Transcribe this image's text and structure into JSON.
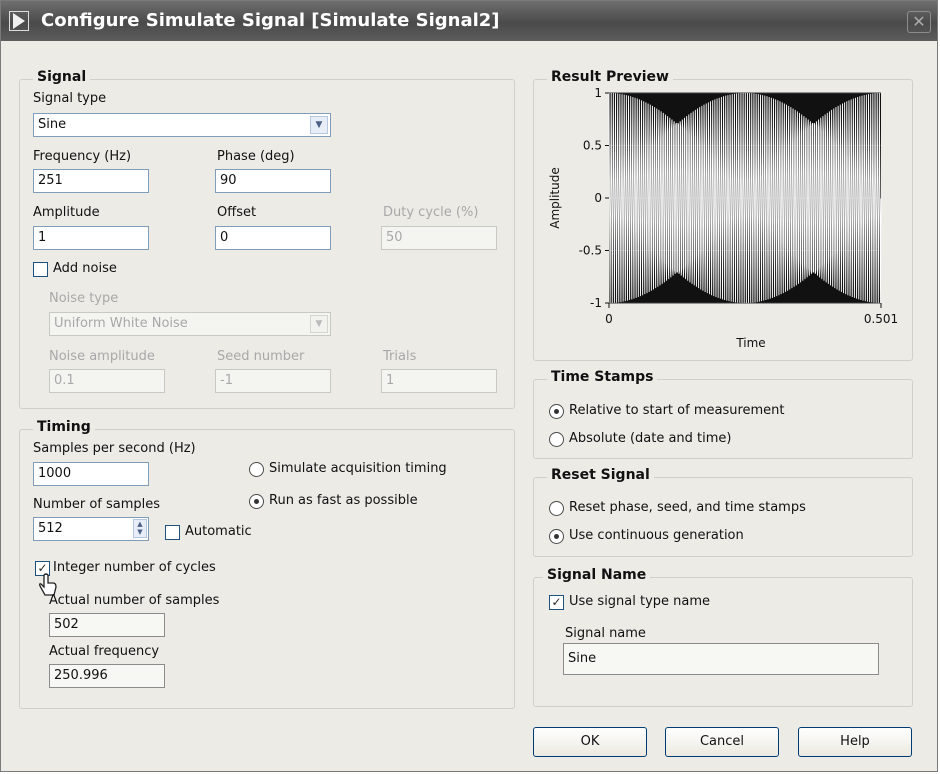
{
  "window": {
    "title": "Configure Simulate Signal [Simulate Signal2]",
    "close_glyph": "✕"
  },
  "signal": {
    "group_title": "Signal",
    "signal_type_label": "Signal type",
    "signal_type_value": "Sine",
    "frequency_label": "Frequency (Hz)",
    "frequency_value": "251",
    "phase_label": "Phase (deg)",
    "phase_value": "90",
    "amplitude_label": "Amplitude",
    "amplitude_value": "1",
    "offset_label": "Offset",
    "offset_value": "0",
    "duty_cycle_label": "Duty cycle (%)",
    "duty_cycle_value": "50",
    "add_noise_label": "Add noise",
    "add_noise_checked": false,
    "noise_type_label": "Noise type",
    "noise_type_value": "Uniform White Noise",
    "noise_amplitude_label": "Noise amplitude",
    "noise_amplitude_value": "0.1",
    "seed_number_label": "Seed number",
    "seed_number_value": "-1",
    "trials_label": "Trials",
    "trials_value": "1"
  },
  "timing": {
    "group_title": "Timing",
    "samples_per_second_label": "Samples per second (Hz)",
    "samples_per_second_value": "1000",
    "simulate_acquisition_label": "Simulate acquisition timing",
    "run_fast_label": "Run as fast as possible",
    "selected_mode": "run_fast",
    "number_of_samples_label": "Number of samples",
    "number_of_samples_value": "512",
    "automatic_label": "Automatic",
    "automatic_checked": false,
    "integer_cycles_label": "Integer number of cycles",
    "integer_cycles_checked": true,
    "actual_samples_label": "Actual number of samples",
    "actual_samples_value": "502",
    "actual_frequency_label": "Actual frequency",
    "actual_frequency_value": "250.996"
  },
  "preview": {
    "group_title": "Result Preview",
    "chart_data": {
      "type": "line",
      "title": "",
      "xlabel": "Time",
      "ylabel": "Amplitude",
      "xlim": [
        0,
        0.501
      ],
      "ylim": [
        -1,
        1
      ],
      "x_ticks": [
        "0",
        "0.501"
      ],
      "y_ticks": [
        "1",
        "0.5",
        "0",
        "-0.5",
        "-1"
      ],
      "sample_rate_hz": 1000,
      "frequency_hz": 250.996,
      "phase_deg": 90,
      "amplitude": 1,
      "num_samples": 502,
      "grid": true,
      "line_color": "#ffffff",
      "plot_bg_color": "#111111"
    }
  },
  "time_stamps": {
    "group_title": "Time Stamps",
    "relative_label": "Relative to start of measurement",
    "absolute_label": "Absolute (date and time)",
    "selected": "relative"
  },
  "reset_signal": {
    "group_title": "Reset Signal",
    "reset_label": "Reset phase, seed, and time stamps",
    "continuous_label": "Use continuous generation",
    "selected": "continuous"
  },
  "signal_name": {
    "group_title": "Signal Name",
    "use_type_name_label": "Use signal type name",
    "use_type_name_checked": true,
    "name_label": "Signal name",
    "name_value": "Sine"
  },
  "buttons": {
    "ok": "OK",
    "cancel": "Cancel",
    "help": "Help"
  },
  "colors": {
    "titlebar": "#5a5a5a",
    "dialog_bg": "#ecebe6",
    "field_border": "#7f9db9",
    "button_border": "#003c74"
  }
}
